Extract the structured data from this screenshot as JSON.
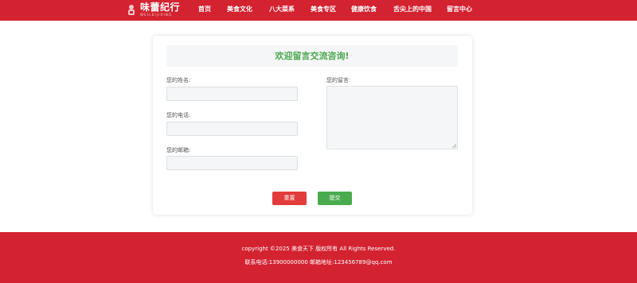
{
  "brand": {
    "name": "味蕾纪行",
    "subtitle": "WEILEIJIXING",
    "colors": {
      "primary": "#d32230",
      "accent": "#49a84c",
      "reset": "#e23b3b"
    }
  },
  "nav": {
    "items": [
      {
        "label": "首页"
      },
      {
        "label": "美食文化"
      },
      {
        "label": "八大菜系"
      },
      {
        "label": "美食专区"
      },
      {
        "label": "健康饮食"
      },
      {
        "label": "舌尖上的中国"
      },
      {
        "label": "留言中心"
      }
    ]
  },
  "form": {
    "title": "欢迎留言交流咨询!",
    "name_label": "您的姓名:",
    "name_value": "",
    "phone_label": "您的电话:",
    "phone_value": "",
    "email_label": "您的邮箱:",
    "email_value": "",
    "message_label": "您的留言:",
    "message_value": "",
    "reset_label": "重置",
    "submit_label": "提交"
  },
  "footer": {
    "copyright": "copyright ©2025 美食天下 版权所有 All Rights Reserved.",
    "contact": "联系电话:13900000000 邮箱地址:123456789@qq.com"
  }
}
